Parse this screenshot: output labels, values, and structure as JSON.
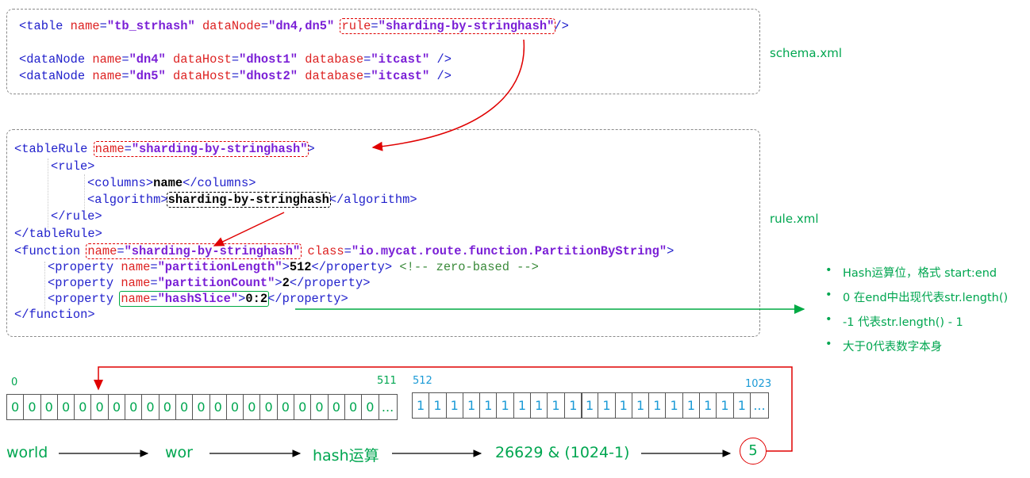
{
  "schema": {
    "file_label": "schema.xml",
    "line1": {
      "open": "<table ",
      "a1": "name",
      "eq1": "=",
      "v1": "\"tb_strhash\"",
      "a2": " dataNode",
      "eq2": "=",
      "v2": "\"dn4,dn5\"",
      "a3": "rule",
      "eq3": "=",
      "v3": "\"sharding-by-stringhash\"",
      "close": "/>"
    },
    "line2": {
      "open": "<dataNode ",
      "a1": "name",
      "v1": "\"dn4\"",
      "a2": " dataHost",
      "v2": "\"dhost1\"",
      "a3": " database",
      "v3": "\"itcast\"",
      "close": " />"
    },
    "line3": {
      "open": "<dataNode ",
      "a1": "name",
      "v1": "\"dn5\"",
      "a2": " dataHost",
      "v2": "\"dhost2\"",
      "a3": " database",
      "v3": "\"itcast\"",
      "close": " />"
    }
  },
  "rule": {
    "file_label": "rule.xml",
    "tableRule_open": "<tableRule ",
    "tableRule_attr": "name",
    "tableRule_val": "\"sharding-by-stringhash\"",
    "tableRule_close": ">",
    "rule_open": "<rule>",
    "columns_open": "<columns>",
    "columns_val": "name",
    "columns_close": "</columns>",
    "algorithm_open": "<algorithm>",
    "algorithm_val": "sharding-by-stringhash",
    "algorithm_close": "</algorithm>",
    "rule_close": "</rule>",
    "tableRule_end": "</tableRule>",
    "function_open": "<function ",
    "function_attr": "name",
    "function_val": "\"sharding-by-stringhash\"",
    "class_attr": " class",
    "class_val": "\"io.mycat.route.function.PartitionByString\"",
    "function_close": ">",
    "prop_open": "<property ",
    "prop_attr": "name",
    "p1_name": "\"partitionLength\"",
    "p1_val": "512",
    "p1_comment": "<!-- zero-based -->",
    "p2_name": "\"partitionCount\"",
    "p2_val": "2",
    "p3_name": "\"hashSlice\"",
    "p3_val": "0:2",
    "prop_close": "</property>",
    "function_end": "</function>"
  },
  "notes": [
    "Hash运算位，格式 start:end",
    "0 在end中出现代表str.length()",
    "-1 代表str.length() - 1",
    "大于0代表数字本身"
  ],
  "slots": {
    "left_start": "0",
    "left_end": "511",
    "right_start": "512",
    "right_end": "1023",
    "left_digit": "0",
    "right_digit": "1",
    "ellipsis": "...",
    "left_count": 22,
    "right_group1_count": 10,
    "right_group2_count": 10
  },
  "flow": {
    "step1": "world",
    "step2": "wor",
    "step3": "hash运算",
    "step4": "26629 & (1024-1)",
    "result": "5"
  },
  "colors": {
    "green": "#00a650",
    "red": "#e00000",
    "blue": "#1a9ad6"
  }
}
